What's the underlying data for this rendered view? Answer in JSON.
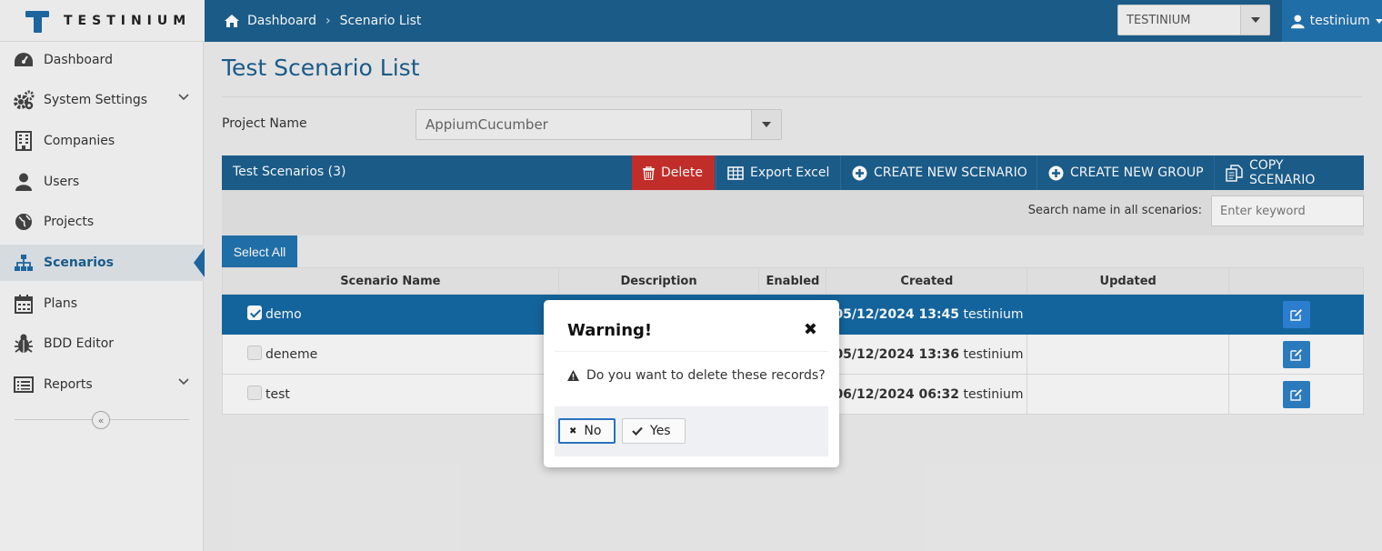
{
  "brand": {
    "name": "TESTINIUM"
  },
  "breadcrumb": {
    "home": "Dashboard",
    "current": "Scenario List"
  },
  "header": {
    "organization": "TESTINIUM",
    "user": "testinium"
  },
  "sidebar": {
    "items": [
      {
        "label": "Dashboard",
        "icon": "dashboard-icon"
      },
      {
        "label": "System Settings",
        "icon": "gears-icon",
        "expandable": true
      },
      {
        "label": "Companies",
        "icon": "building-icon"
      },
      {
        "label": "Users",
        "icon": "user-icon"
      },
      {
        "label": "Projects",
        "icon": "globe-icon"
      },
      {
        "label": "Scenarios",
        "icon": "sitemap-icon",
        "active": true
      },
      {
        "label": "Plans",
        "icon": "calendar-icon"
      },
      {
        "label": "BDD Editor",
        "icon": "bug-icon"
      },
      {
        "label": "Reports",
        "icon": "list-icon",
        "expandable": true
      }
    ]
  },
  "main": {
    "title": "Test Scenario List",
    "project_label": "Project Name",
    "project_value": "AppiumCucumber",
    "panel": {
      "title": "Test Scenarios (3)",
      "delete": "Delete",
      "export": "Export Excel",
      "create_scenario": "CREATE NEW SCENARIO",
      "create_group": "CREATE NEW GROUP",
      "copy": "COPY SCENARIO"
    },
    "search": {
      "label": "Search name in all scenarios:",
      "placeholder": "Enter keyword"
    },
    "select_all": "Select All",
    "table": {
      "headers": [
        "Scenario Name",
        "Description",
        "Enabled",
        "Created",
        "Updated",
        ""
      ],
      "rows": [
        {
          "name": "demo",
          "checked": true,
          "created_date": "05/12/2024 13:45",
          "created_by": "testinium"
        },
        {
          "name": "deneme",
          "checked": false,
          "created_date": "05/12/2024 13:36",
          "created_by": "testinium"
        },
        {
          "name": "test",
          "checked": false,
          "created_date": "06/12/2024 06:32",
          "created_by": "testinium"
        }
      ]
    }
  },
  "modal": {
    "title": "Warning!",
    "message": "Do you want to delete these records?",
    "no": "No",
    "yes": "Yes"
  },
  "colors": {
    "primary": "#1c5f8e",
    "danger": "#c9302c",
    "selected_row": "#1469a3"
  }
}
